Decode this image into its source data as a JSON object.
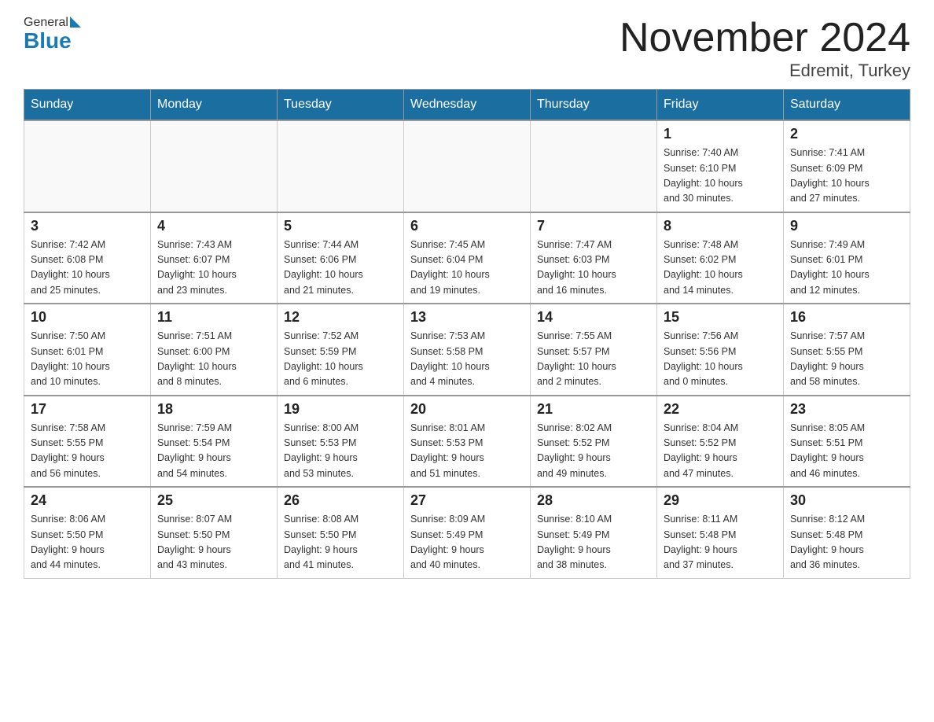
{
  "header": {
    "logo_general": "General",
    "logo_blue": "Blue",
    "title": "November 2024",
    "subtitle": "Edremit, Turkey"
  },
  "weekdays": [
    "Sunday",
    "Monday",
    "Tuesday",
    "Wednesday",
    "Thursday",
    "Friday",
    "Saturday"
  ],
  "weeks": [
    [
      {
        "day": "",
        "info": ""
      },
      {
        "day": "",
        "info": ""
      },
      {
        "day": "",
        "info": ""
      },
      {
        "day": "",
        "info": ""
      },
      {
        "day": "",
        "info": ""
      },
      {
        "day": "1",
        "info": "Sunrise: 7:40 AM\nSunset: 6:10 PM\nDaylight: 10 hours\nand 30 minutes."
      },
      {
        "day": "2",
        "info": "Sunrise: 7:41 AM\nSunset: 6:09 PM\nDaylight: 10 hours\nand 27 minutes."
      }
    ],
    [
      {
        "day": "3",
        "info": "Sunrise: 7:42 AM\nSunset: 6:08 PM\nDaylight: 10 hours\nand 25 minutes."
      },
      {
        "day": "4",
        "info": "Sunrise: 7:43 AM\nSunset: 6:07 PM\nDaylight: 10 hours\nand 23 minutes."
      },
      {
        "day": "5",
        "info": "Sunrise: 7:44 AM\nSunset: 6:06 PM\nDaylight: 10 hours\nand 21 minutes."
      },
      {
        "day": "6",
        "info": "Sunrise: 7:45 AM\nSunset: 6:04 PM\nDaylight: 10 hours\nand 19 minutes."
      },
      {
        "day": "7",
        "info": "Sunrise: 7:47 AM\nSunset: 6:03 PM\nDaylight: 10 hours\nand 16 minutes."
      },
      {
        "day": "8",
        "info": "Sunrise: 7:48 AM\nSunset: 6:02 PM\nDaylight: 10 hours\nand 14 minutes."
      },
      {
        "day": "9",
        "info": "Sunrise: 7:49 AM\nSunset: 6:01 PM\nDaylight: 10 hours\nand 12 minutes."
      }
    ],
    [
      {
        "day": "10",
        "info": "Sunrise: 7:50 AM\nSunset: 6:01 PM\nDaylight: 10 hours\nand 10 minutes."
      },
      {
        "day": "11",
        "info": "Sunrise: 7:51 AM\nSunset: 6:00 PM\nDaylight: 10 hours\nand 8 minutes."
      },
      {
        "day": "12",
        "info": "Sunrise: 7:52 AM\nSunset: 5:59 PM\nDaylight: 10 hours\nand 6 minutes."
      },
      {
        "day": "13",
        "info": "Sunrise: 7:53 AM\nSunset: 5:58 PM\nDaylight: 10 hours\nand 4 minutes."
      },
      {
        "day": "14",
        "info": "Sunrise: 7:55 AM\nSunset: 5:57 PM\nDaylight: 10 hours\nand 2 minutes."
      },
      {
        "day": "15",
        "info": "Sunrise: 7:56 AM\nSunset: 5:56 PM\nDaylight: 10 hours\nand 0 minutes."
      },
      {
        "day": "16",
        "info": "Sunrise: 7:57 AM\nSunset: 5:55 PM\nDaylight: 9 hours\nand 58 minutes."
      }
    ],
    [
      {
        "day": "17",
        "info": "Sunrise: 7:58 AM\nSunset: 5:55 PM\nDaylight: 9 hours\nand 56 minutes."
      },
      {
        "day": "18",
        "info": "Sunrise: 7:59 AM\nSunset: 5:54 PM\nDaylight: 9 hours\nand 54 minutes."
      },
      {
        "day": "19",
        "info": "Sunrise: 8:00 AM\nSunset: 5:53 PM\nDaylight: 9 hours\nand 53 minutes."
      },
      {
        "day": "20",
        "info": "Sunrise: 8:01 AM\nSunset: 5:53 PM\nDaylight: 9 hours\nand 51 minutes."
      },
      {
        "day": "21",
        "info": "Sunrise: 8:02 AM\nSunset: 5:52 PM\nDaylight: 9 hours\nand 49 minutes."
      },
      {
        "day": "22",
        "info": "Sunrise: 8:04 AM\nSunset: 5:52 PM\nDaylight: 9 hours\nand 47 minutes."
      },
      {
        "day": "23",
        "info": "Sunrise: 8:05 AM\nSunset: 5:51 PM\nDaylight: 9 hours\nand 46 minutes."
      }
    ],
    [
      {
        "day": "24",
        "info": "Sunrise: 8:06 AM\nSunset: 5:50 PM\nDaylight: 9 hours\nand 44 minutes."
      },
      {
        "day": "25",
        "info": "Sunrise: 8:07 AM\nSunset: 5:50 PM\nDaylight: 9 hours\nand 43 minutes."
      },
      {
        "day": "26",
        "info": "Sunrise: 8:08 AM\nSunset: 5:50 PM\nDaylight: 9 hours\nand 41 minutes."
      },
      {
        "day": "27",
        "info": "Sunrise: 8:09 AM\nSunset: 5:49 PM\nDaylight: 9 hours\nand 40 minutes."
      },
      {
        "day": "28",
        "info": "Sunrise: 8:10 AM\nSunset: 5:49 PM\nDaylight: 9 hours\nand 38 minutes."
      },
      {
        "day": "29",
        "info": "Sunrise: 8:11 AM\nSunset: 5:48 PM\nDaylight: 9 hours\nand 37 minutes."
      },
      {
        "day": "30",
        "info": "Sunrise: 8:12 AM\nSunset: 5:48 PM\nDaylight: 9 hours\nand 36 minutes."
      }
    ]
  ]
}
